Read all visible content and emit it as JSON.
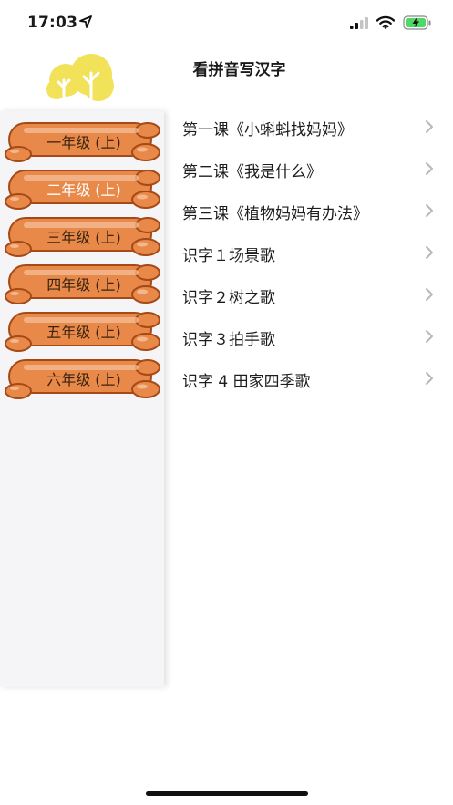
{
  "status_bar": {
    "time": "17:03"
  },
  "header": {
    "title": "看拼音写汉字"
  },
  "sidebar": {
    "grades": [
      {
        "label": "一年级 (上)"
      },
      {
        "label": "二年级 (上)"
      },
      {
        "label": "三年级 (上)"
      },
      {
        "label": "四年级 (上)"
      },
      {
        "label": "五年级 (上)"
      },
      {
        "label": "六年级 (上)"
      }
    ]
  },
  "lessons": [
    {
      "label": "第一课《小蝌蚪找妈妈》"
    },
    {
      "label": "第二课《我是什么》"
    },
    {
      "label": "第三课《植物妈妈有办法》"
    },
    {
      "label": "识字１场景歌"
    },
    {
      "label": "识字２树之歌"
    },
    {
      "label": "识字３拍手歌"
    },
    {
      "label": "识字 4 田家四季歌"
    }
  ],
  "icons": {
    "logo": "yellow-tree-icon",
    "status": [
      "location-arrow-icon",
      "signal-icon",
      "wifi-icon",
      "battery-charging-icon"
    ],
    "row_chevron": "chevron-right-icon"
  },
  "colors": {
    "grade_button": "#e8894a",
    "grade_button_outline": "#a54a17",
    "logo_yellow": "#f1e25a",
    "sidebar_bg": "#f5f5f7",
    "battery_green": "#4cd964"
  }
}
